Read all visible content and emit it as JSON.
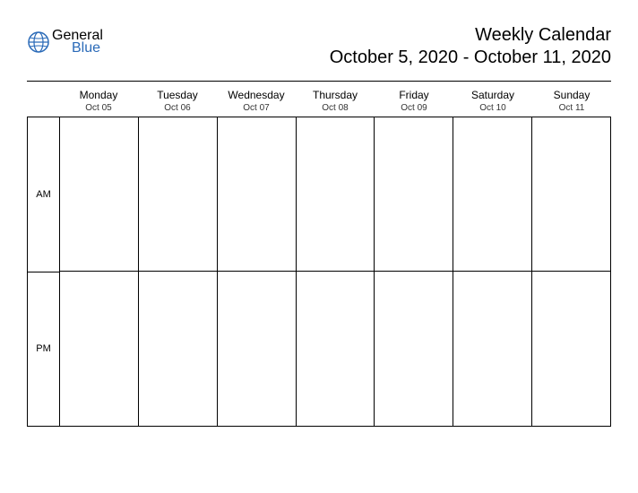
{
  "logo": {
    "word1": "General",
    "word2": "Blue"
  },
  "title": "Weekly Calendar",
  "date_range": "October 5, 2020 - October 11, 2020",
  "periods": [
    "AM",
    "PM"
  ],
  "days": [
    {
      "name": "Monday",
      "date": "Oct 05"
    },
    {
      "name": "Tuesday",
      "date": "Oct 06"
    },
    {
      "name": "Wednesday",
      "date": "Oct 07"
    },
    {
      "name": "Thursday",
      "date": "Oct 08"
    },
    {
      "name": "Friday",
      "date": "Oct 09"
    },
    {
      "name": "Saturday",
      "date": "Oct 10"
    },
    {
      "name": "Sunday",
      "date": "Oct 11"
    }
  ]
}
